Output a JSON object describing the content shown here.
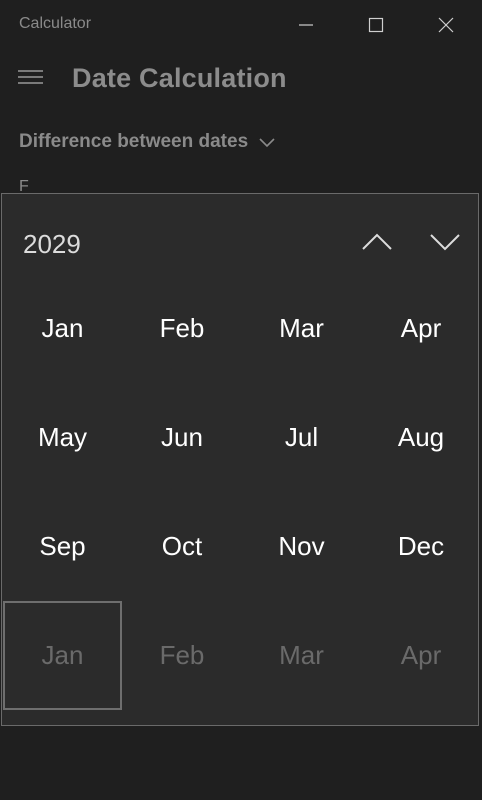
{
  "window": {
    "app_title": "Calculator",
    "minimize_icon": "minimize-icon",
    "maximize_icon": "maximize-icon",
    "close_icon": "close-icon"
  },
  "header": {
    "menu_icon": "hamburger-icon",
    "title": "Date Calculation"
  },
  "mode": {
    "selected": "Difference between dates",
    "icon": "chevron-down-icon"
  },
  "behind": {
    "from_label": "F"
  },
  "picker": {
    "year": "2029",
    "prev_icon": "chevron-up-icon",
    "next_icon": "chevron-down-icon",
    "months": [
      {
        "label": "Jan",
        "dim": false
      },
      {
        "label": "Feb",
        "dim": false
      },
      {
        "label": "Mar",
        "dim": false
      },
      {
        "label": "Apr",
        "dim": false
      },
      {
        "label": "May",
        "dim": false
      },
      {
        "label": "Jun",
        "dim": false
      },
      {
        "label": "Jul",
        "dim": false
      },
      {
        "label": "Aug",
        "dim": false
      },
      {
        "label": "Sep",
        "dim": false
      },
      {
        "label": "Oct",
        "dim": false
      },
      {
        "label": "Nov",
        "dim": false
      },
      {
        "label": "Dec",
        "dim": false
      },
      {
        "label": "Jan",
        "dim": true,
        "focused": true
      },
      {
        "label": "Feb",
        "dim": true
      },
      {
        "label": "Mar",
        "dim": true
      },
      {
        "label": "Apr",
        "dim": true
      }
    ]
  },
  "colors": {
    "background": "#1f1f1f",
    "picker_bg": "#2b2b2b",
    "picker_border": "#6a6a6a",
    "text": "#ffffff",
    "dim_text": "#6a6a6a"
  }
}
